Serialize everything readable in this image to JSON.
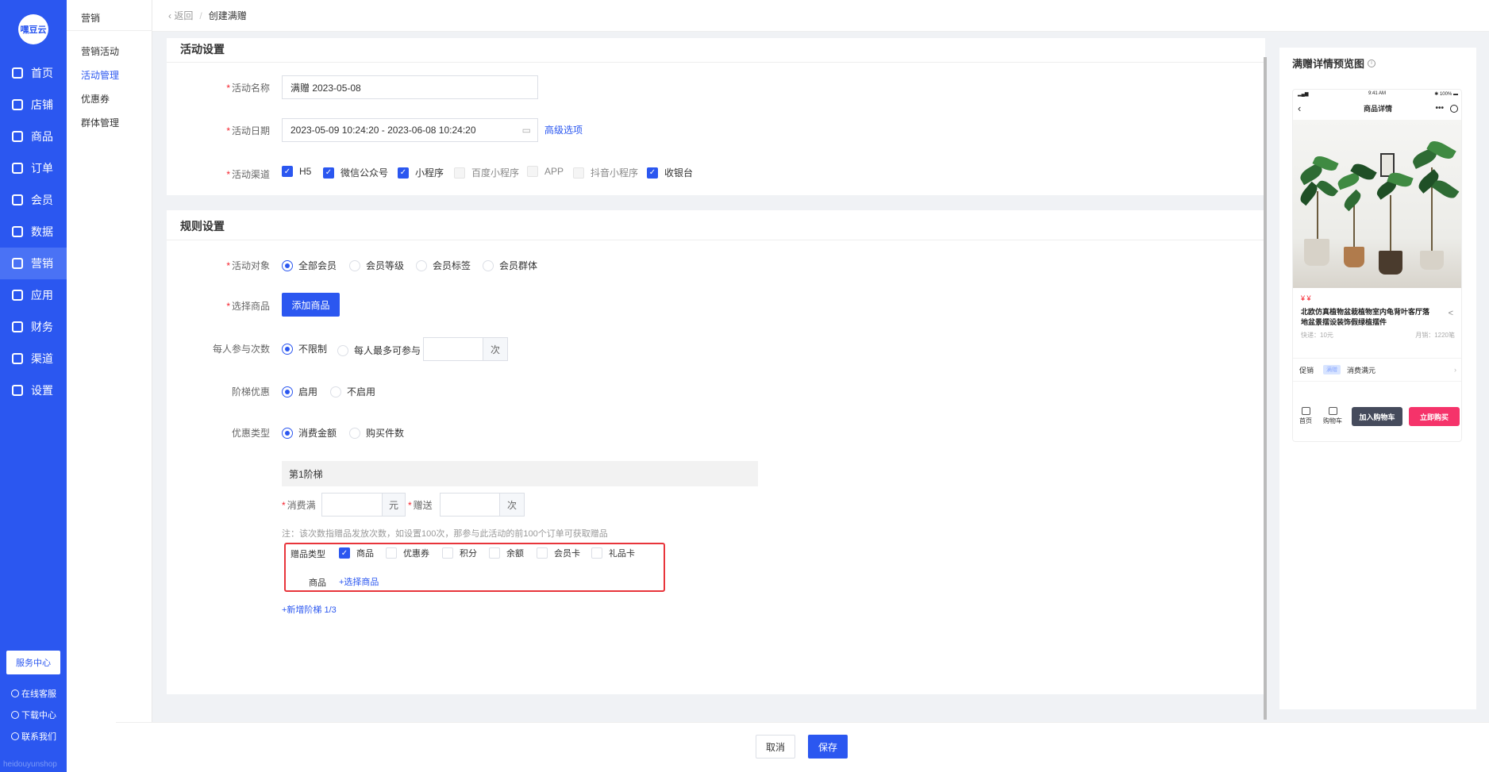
{
  "brand": {
    "logo_text": "嘿豆云",
    "footer_text": "heidouyunshop"
  },
  "nav": {
    "items": [
      {
        "label": "首页",
        "icon": "home-icon"
      },
      {
        "label": "店铺",
        "icon": "store-icon"
      },
      {
        "label": "商品",
        "icon": "goods-icon"
      },
      {
        "label": "订单",
        "icon": "order-icon"
      },
      {
        "label": "会员",
        "icon": "user-icon"
      },
      {
        "label": "数据",
        "icon": "chart-icon"
      },
      {
        "label": "营销",
        "icon": "tag-icon",
        "active": true
      },
      {
        "label": "应用",
        "icon": "app-icon"
      },
      {
        "label": "财务",
        "icon": "finance-icon"
      },
      {
        "label": "渠道",
        "icon": "channel-icon"
      },
      {
        "label": "设置",
        "icon": "gear-icon"
      }
    ],
    "service_center": "服务中心",
    "links": [
      "在线客服",
      "下载中心",
      "联系我们"
    ]
  },
  "submenu": {
    "title": "营销",
    "items": [
      "营销活动",
      "活动管理",
      "优惠券",
      "群体管理"
    ],
    "active_index": 1
  },
  "breadcrumb": {
    "back": "返回",
    "sep": "/",
    "current": "创建满赠"
  },
  "activity": {
    "section_title": "活动设置",
    "name_label": "活动名称",
    "name_value": "满赠  2023-05-08",
    "date_label": "活动日期",
    "date_value": "2023-05-09 10:24:20 - 2023-06-08 10:24:20",
    "advanced_link": "高级选项",
    "channel_label": "活动渠道",
    "channels": [
      {
        "label": "H5",
        "checked": true
      },
      {
        "label": "微信公众号",
        "checked": true
      },
      {
        "label": "小程序",
        "checked": true
      },
      {
        "label": "百度小程序",
        "checked": false
      },
      {
        "label": "APP",
        "checked": false
      },
      {
        "label": "抖音小程序",
        "checked": false
      },
      {
        "label": "收银台",
        "checked": true
      }
    ]
  },
  "rules": {
    "section_title": "规则设置",
    "target_label": "活动对象",
    "targets": [
      "全部会员",
      "会员等级",
      "会员标签",
      "会员群体"
    ],
    "target_selected": 0,
    "goods_label": "选择商品",
    "add_goods_button": "添加商品",
    "times_label": "每人参与次数",
    "times_options": [
      "不限制",
      "每人最多可参与"
    ],
    "times_selected": 0,
    "times_unit": "次",
    "tier_label": "阶梯优惠",
    "tier_options": [
      "启用",
      "不启用"
    ],
    "tier_selected": 0,
    "discount_label": "优惠类型",
    "discount_options": [
      "消费金额",
      "购买件数"
    ],
    "discount_selected": 0,
    "tier1_title": "第1阶梯",
    "spend_label": "消费满",
    "spend_unit": "元",
    "gift_label": "赠送",
    "gift_unit": "次",
    "note": "注：该次数指赠品发放次数，如设置100次，那参与此活动的前100个订单可获取赠品",
    "gift_type_label": "赠品类型",
    "gift_types": [
      {
        "label": "商品",
        "checked": true
      },
      {
        "label": "优惠券",
        "checked": false
      },
      {
        "label": "积分",
        "checked": false
      },
      {
        "label": "余额",
        "checked": false
      },
      {
        "label": "会员卡",
        "checked": false
      },
      {
        "label": "礼品卡",
        "checked": false
      }
    ],
    "goods_row_label": "商品",
    "choose_goods_link": "+选择商品",
    "add_tier_link": "+新增阶梯 1/3"
  },
  "preview": {
    "title": "满赠详情预览图",
    "status_time": "9:41 AM",
    "status_battery": "100%",
    "page_title": "商品详情",
    "price": "¥ ¥",
    "product_name": "北欧仿真植物盆栽植物室内龟背叶客厅落地盆景摆设装饰假绿植摆件",
    "shipping": "快递：10元",
    "sales": "月销：1220笔",
    "promo_label": "促销",
    "promo_tag": "满赠",
    "promo_text": "消费满元",
    "footer_home": "首页",
    "footer_cart": "购物车",
    "add_cart_button": "加入购物车",
    "buy_button": "立即购买"
  },
  "actions": {
    "cancel": "取消",
    "save": "保存"
  },
  "colors": {
    "primary": "#2b57f0",
    "danger": "#e8353b",
    "buy": "#f5336a"
  }
}
